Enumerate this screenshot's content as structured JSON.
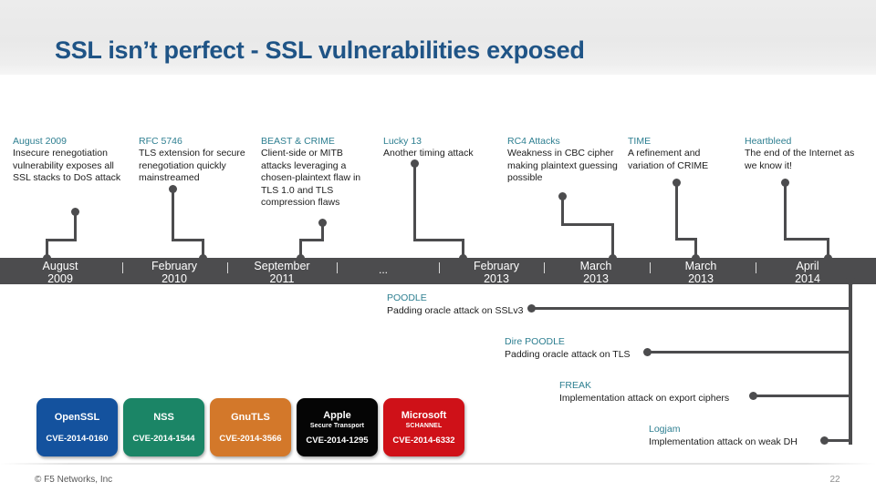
{
  "header": {
    "title": "SSL isn’t perfect - SSL vulnerabilities exposed",
    "accent_color": "#1f5486",
    "band_color": "#ececec"
  },
  "timeline": {
    "bar_color": "#4c4c4e",
    "ellipsis": "...",
    "marks": [
      {
        "month": "August",
        "year": "2009"
      },
      {
        "month": "February",
        "year": "2010"
      },
      {
        "month": "September",
        "year": "2011"
      },
      {
        "month": "February",
        "year": "2013"
      },
      {
        "month": "March",
        "year": "2013"
      },
      {
        "month": "March",
        "year": "2013"
      },
      {
        "month": "April",
        "year": "2014"
      }
    ]
  },
  "events": [
    {
      "title": "August 2009",
      "desc": "Insecure renegotiation vulnerability exposes all SSL stacks to DoS attack"
    },
    {
      "title": "RFC 5746",
      "desc": "TLS extension for secure renegotiation quickly mainstreamed"
    },
    {
      "title": "BEAST & CRIME",
      "desc": "Client-side or MITB attacks leveraging a chosen-plaintext flaw in TLS 1.0 and TLS compression flaws"
    },
    {
      "title": "Lucky 13",
      "desc": "Another timing attack"
    },
    {
      "title": "RC4 Attacks",
      "desc": "Weakness in CBC cipher making plaintext guessing possible"
    },
    {
      "title": "TIME",
      "desc": "A refinement and variation of CRIME"
    },
    {
      "title": "Heartbleed",
      "desc": "The end of the Internet as we know it!"
    }
  ],
  "lower_attacks": [
    {
      "title": "POODLE",
      "desc": "Padding oracle attack on SSLv3"
    },
    {
      "title": "Dire POODLE",
      "desc": "Padding oracle attack on TLS"
    },
    {
      "title": "FREAK",
      "desc": "Implementation attack on export ciphers"
    },
    {
      "title": "Logjam",
      "desc": "Implementation attack on weak DH"
    }
  ],
  "vendors": [
    {
      "name": "OpenSSL",
      "sub": "",
      "cve": "CVE-2014-0160",
      "color": "#14529e"
    },
    {
      "name": "NSS",
      "sub": "",
      "cve": "CVE-2014-1544",
      "color": "#1b8566"
    },
    {
      "name": "GnuTLS",
      "sub": "",
      "cve": "CVE-2014-3566",
      "color": "#d3782a"
    },
    {
      "name": "Apple",
      "sub": "Secure Transport",
      "cve": "CVE-2014-1295",
      "color": "#050505"
    },
    {
      "name": "Microsoft",
      "sub": "SCHANNEL",
      "cve": "CVE-2014-6332",
      "color": "#cf1118"
    }
  ],
  "footer": {
    "copyright": "© F5 Networks, Inc",
    "page_number": "22"
  }
}
